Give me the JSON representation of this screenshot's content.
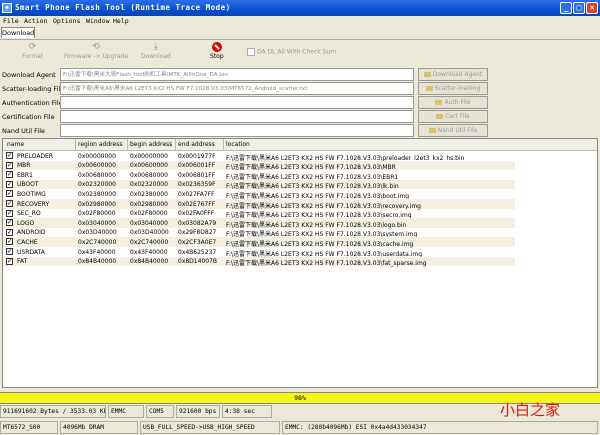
{
  "window": {
    "title": "Smart Phone Flash Tool (Runtime Trace Mode)",
    "min": "_",
    "max": "□",
    "close": "×"
  },
  "menu": [
    "File",
    "Action",
    "Options",
    "Window",
    "Help"
  ],
  "tabs": [
    "Download"
  ],
  "toolbar": {
    "format": "Format",
    "firmware_upgrade": "Firmware -> Upgrade",
    "download": "Download",
    "stop": "Stop",
    "da_dl_all": "DA DL All With Check Sum"
  },
  "files": [
    {
      "label": "Download Agent",
      "value": "F:\\迅雷下载\\黑米大哥Flash_tool刷机工具\\MTK_AllInOne_DA.bin",
      "button": "Download Agent"
    },
    {
      "label": "Scatter-loading File",
      "value": "F:\\迅雷下载\\黑米A6\\黑米A6 L2ET3 KX2 HS FW F7.1028.V3.03\\MT6572_Android_scatter.txt",
      "button": "Scatter-loading"
    },
    {
      "label": "Authentication File",
      "value": "",
      "button": "Auth File"
    },
    {
      "label": "Certification File",
      "value": "",
      "button": "Cert File"
    },
    {
      "label": "Nand Util File",
      "value": "",
      "button": "Nand Util File"
    }
  ],
  "table": {
    "columns": [
      "name",
      "region address",
      "begin address",
      "end address",
      "location"
    ],
    "rows": [
      {
        "name": "PRELOADER",
        "region": "0x00000000",
        "begin": "0x00000000",
        "end": "0x0001977F",
        "loc": "F:\\迅雷下载\\黑米A6 L2ET3 KX2 HS FW F7.1028.V3.03\\preloader_l2et3_kx2_hs.bin"
      },
      {
        "name": "MBR",
        "region": "0x00600000",
        "begin": "0x00600000",
        "end": "0x006001FF",
        "loc": "F:\\迅雷下载\\黑米A6 L2ET3 KX2 HS FW F7.1028.V3.03\\MBR"
      },
      {
        "name": "EBR1",
        "region": "0x00680000",
        "begin": "0x00680000",
        "end": "0x006801FF",
        "loc": "F:\\迅雷下载\\黑米A6 L2ET3 KX2 HS FW F7.1028.V3.03\\EBR1"
      },
      {
        "name": "UBOOT",
        "region": "0x02320000",
        "begin": "0x02320000",
        "end": "0x0236359F",
        "loc": "F:\\迅雷下载\\黑米A6 L2ET3 KX2 HS FW F7.1028.V3.03\\lk.bin"
      },
      {
        "name": "BOOTIMG",
        "region": "0x02380000",
        "begin": "0x02380000",
        "end": "0x027FA7FF",
        "loc": "F:\\迅雷下载\\黑米A6 L2ET3 KX2 HS FW F7.1028.V3.03\\boot.img"
      },
      {
        "name": "RECOVERY",
        "region": "0x02980000",
        "begin": "0x02980000",
        "end": "0x02E767FF",
        "loc": "F:\\迅雷下载\\黑米A6 L2ET3 KX2 HS FW F7.1028.V3.03\\recovery.img"
      },
      {
        "name": "SEC_RO",
        "region": "0x02F80000",
        "begin": "0x02F80000",
        "end": "0x02FA0FFF",
        "loc": "F:\\迅雷下载\\黑米A6 L2ET3 KX2 HS FW F7.1028.V3.03\\secro.img"
      },
      {
        "name": "LOGO",
        "region": "0x03040000",
        "begin": "0x03040000",
        "end": "0x03082A79",
        "loc": "F:\\迅雷下载\\黑米A6 L2ET3 KX2 HS FW F7.1028.V3.03\\logo.bin"
      },
      {
        "name": "ANDROID",
        "region": "0x03D40000",
        "begin": "0x03D40000",
        "end": "0x29F8D827",
        "loc": "F:\\迅雷下载\\黑米A6 L2ET3 KX2 HS FW F7.1028.V3.03\\system.img"
      },
      {
        "name": "CACHE",
        "region": "0x2C740000",
        "begin": "0x2C740000",
        "end": "0x2CF3A0E7",
        "loc": "F:\\迅雷下载\\黑米A6 L2ET3 KX2 HS FW F7.1028.V3.03\\cache.img"
      },
      {
        "name": "USRDATA",
        "region": "0x43F40000",
        "begin": "0x43F40000",
        "end": "0x4B625237",
        "loc": "F:\\迅雷下载\\黑米A6 L2ET3 KX2 HS FW F7.1028.V3.03\\userdata.img"
      },
      {
        "name": "FAT",
        "region": "0x84B40000",
        "begin": "0x84B40000",
        "end": "0x8D14007B",
        "loc": "F:\\迅雷下载\\黑米A6 L2ET3 KX2 HS FW F7.1028.V3.03\\fat_sparse.img"
      }
    ]
  },
  "progress": {
    "text": "98%",
    "fraction": 0.98
  },
  "status1": [
    "911691602 Bytes / 3533.03 KBps",
    "EMMC",
    "COM5",
    "921600 bps",
    "4:38 sec"
  ],
  "status2": [
    "MT6572_S00",
    "4096Mb DRAM",
    "USB_FULL_SPEED->USB_HIGH_SPEED",
    "EMMC: (280b4096Mb) ESI 0x4a4d433034347"
  ],
  "watermark": "小白之家",
  "colors": {
    "titlebar": "#0a4fd0",
    "progress": "#f5f51a",
    "stop": "#dd0000",
    "watermark": "#ee1111"
  }
}
